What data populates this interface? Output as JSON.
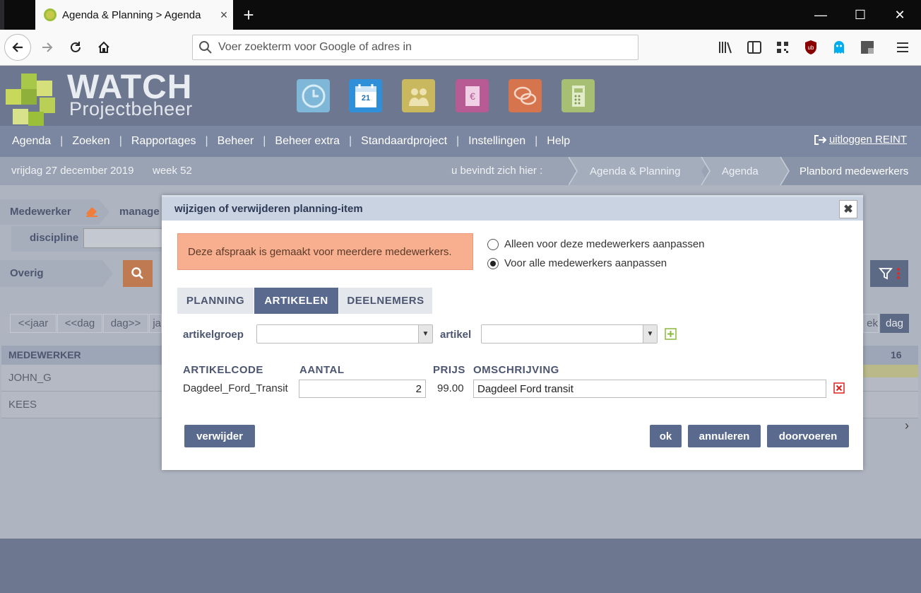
{
  "browser": {
    "tab_title": "Agenda & Planning > Agenda",
    "tab_close": "×",
    "new_tab": "+",
    "url_placeholder": "Voer zoekterm voor Google of adres in",
    "win_min": "—",
    "win_max": "☐",
    "win_close": "✕"
  },
  "header": {
    "logo_title": "WATCH",
    "logo_subtitle": "Projectbeheer",
    "apps": [
      "clock-icon",
      "calendar-icon",
      "people-icon",
      "invoice-icon",
      "chat-icon",
      "calculator-icon"
    ],
    "calendar_day": "21"
  },
  "menu": {
    "items": [
      "Agenda",
      "Zoeken",
      "Rapportages",
      "Beheer",
      "Beheer extra",
      "Standaardproject",
      "Instellingen",
      "Help"
    ],
    "separator": "|",
    "logout": "uitloggen REINT"
  },
  "crumbbar": {
    "date": "vrijdag 27 december 2019",
    "week": "week 52",
    "you_are_here": "u bevindt zich hier :",
    "crumbs": [
      "Agenda & Planning",
      "Agenda",
      "Planbord medewerkers"
    ]
  },
  "background": {
    "medewerker_label": "Medewerker",
    "manager_label": "manage",
    "discipline_label": "discipline",
    "overig_label": "Overig",
    "nav_buttons": [
      "<<jaar",
      "<<dag",
      "dag>>",
      "ja"
    ],
    "view_buttons": [
      "ek",
      "dag"
    ],
    "table_header": "MEDEWERKER",
    "day_number": "16",
    "rows": [
      "JOHN_G",
      "KEES"
    ],
    "scroll_arrow": "›"
  },
  "modal": {
    "title": "wijzigen of verwijderen planning-item",
    "close": "✖",
    "alert": "Deze afspraak is gemaakt voor meerdere medewerkers.",
    "radio_options": [
      {
        "label": "Alleen voor deze medewerkers aanpassen",
        "checked": false
      },
      {
        "label": "Voor alle medewerkers aanpassen",
        "checked": true
      }
    ],
    "tabs": [
      "PLANNING",
      "ARTIKELEN",
      "DEELNEMERS"
    ],
    "active_tab": "ARTIKELEN",
    "artikelgroep_label": "artikelgroep",
    "artikelgroep_value": "",
    "artikel_label": "artikel",
    "artikel_value": "",
    "columns": [
      "ARTIKELCODE",
      "AANTAL",
      "PRIJS",
      "OMSCHRIJVING"
    ],
    "rows": [
      {
        "artikelcode": "Dagdeel_Ford_Transit",
        "aantal": "2",
        "prijs": "99.00",
        "omschrijving": "Dagdeel Ford transit"
      }
    ],
    "buttons": {
      "verwijder": "verwijder",
      "ok": "ok",
      "annuleren": "annuleren",
      "doorvoeren": "doorvoeren"
    }
  },
  "colors": {
    "header_bg": "#6d7890",
    "menu_bg": "#7b86a0",
    "button_bg": "#5a6a8e",
    "alert_bg": "#f8af8f",
    "search_orange": "#ef7d3c"
  }
}
